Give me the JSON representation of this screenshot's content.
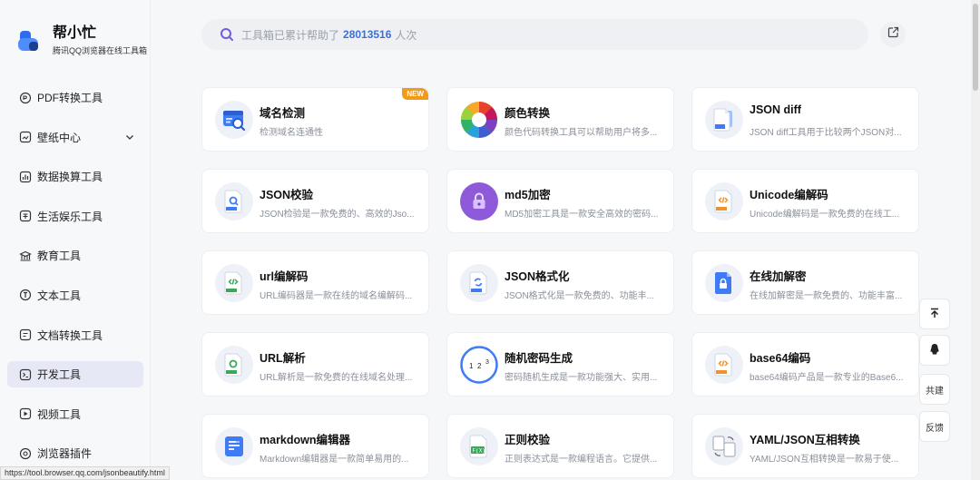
{
  "brand": {
    "title": "帮小忙",
    "subtitle": "腾讯QQ浏览器在线工具箱"
  },
  "nav": [
    {
      "label": "PDF转换工具",
      "icon": "pdf-icon"
    },
    {
      "label": "壁纸中心",
      "icon": "wallpaper-icon",
      "expandable": true
    },
    {
      "label": "数据换算工具",
      "icon": "data-icon"
    },
    {
      "label": "生活娱乐工具",
      "icon": "life-icon"
    },
    {
      "label": "教育工具",
      "icon": "education-icon"
    },
    {
      "label": "文本工具",
      "icon": "text-icon"
    },
    {
      "label": "文档转换工具",
      "icon": "doc-icon"
    },
    {
      "label": "开发工具",
      "icon": "dev-icon",
      "active": true
    },
    {
      "label": "视频工具",
      "icon": "video-icon"
    },
    {
      "label": "浏览器插件",
      "icon": "plugin-icon"
    }
  ],
  "search": {
    "prefix": "工具箱已累计帮助了",
    "count": "28013516",
    "suffix": "人次"
  },
  "cards": [
    {
      "title": "域名检测",
      "desc": "检测域名连通性",
      "badge": "NEW",
      "icon": "domain-check-icon"
    },
    {
      "title": "颜色转换",
      "desc": "颜色代码转换工具可以帮助用户将多...",
      "icon": "color-wheel-icon"
    },
    {
      "title": "JSON diff",
      "desc": "JSON diff工具用于比较两个JSON对...",
      "icon": "json-diff-icon"
    },
    {
      "title": "JSON校验",
      "desc": "JSON检验是一款免费的、高效的Jso...",
      "icon": "json-check-icon"
    },
    {
      "title": "md5加密",
      "desc": "MD5加密工具是一款安全高效的密码...",
      "icon": "lock-icon"
    },
    {
      "title": "Unicode编解码",
      "desc": "Unicode编解码是一款免费的在线工...",
      "icon": "unicode-icon"
    },
    {
      "title": "url编解码",
      "desc": "URL编码器是一款在线的域名编解码...",
      "icon": "url-code-icon"
    },
    {
      "title": "JSON格式化",
      "desc": "JSON格式化是一款免费的、功能丰...",
      "icon": "json-format-icon"
    },
    {
      "title": "在线加解密",
      "desc": "在线加解密是一款免费的、功能丰富...",
      "icon": "encrypt-icon"
    },
    {
      "title": "URL解析",
      "desc": "URL解析是一款免费的在线域名处理...",
      "icon": "url-parse-icon"
    },
    {
      "title": "随机密码生成",
      "desc": "密码随机生成是一款功能强大、实用...",
      "icon": "random-password-icon"
    },
    {
      "title": "base64编码",
      "desc": "base64编码产品是一款专业的Base6...",
      "icon": "base64-icon"
    },
    {
      "title": "markdown编辑器",
      "desc": "Markdown编辑器是一款简单易用的...",
      "icon": "markdown-icon"
    },
    {
      "title": "正则校验",
      "desc": "正则表达式是一款编程语言。它提供...",
      "icon": "regex-icon"
    },
    {
      "title": "YAML/JSON互相转换",
      "desc": "YAML/JSON互相转换是一款易于使...",
      "icon": "yaml-json-icon"
    }
  ],
  "float": {
    "top": "back-to-top-icon",
    "qq": "qq-icon",
    "build_label": "共建",
    "feedback_label": "反馈"
  },
  "status_url": "https://tool.browser.qq.com/jsonbeautify.html",
  "colors": {
    "accent": "#3d6fd9",
    "badge": "#f39a1a"
  }
}
